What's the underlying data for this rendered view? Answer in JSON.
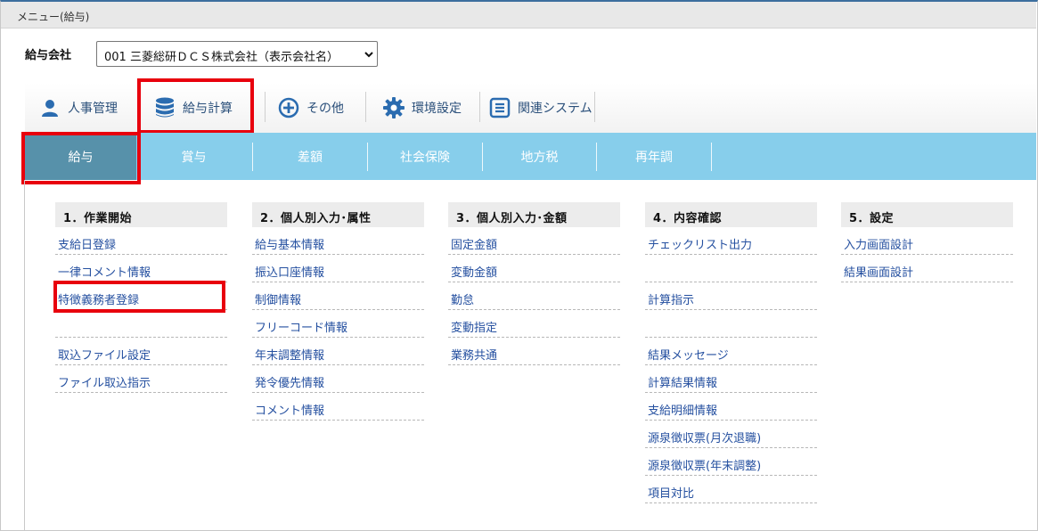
{
  "window": {
    "title": "メニュー(給与)"
  },
  "company": {
    "label": "給与会社",
    "selected": "001 三菱総研ＤＣＳ株式会社（表示会社名）"
  },
  "nav": [
    {
      "label": "人事管理",
      "icon": "person-icon"
    },
    {
      "label": "給与計算",
      "icon": "database-icon"
    },
    {
      "label": "その他",
      "icon": "plus-circle-icon"
    },
    {
      "label": "環境設定",
      "icon": "gear-icon"
    },
    {
      "label": "関連システム",
      "icon": "list-box-icon"
    }
  ],
  "tabs": [
    "給与",
    "賞与",
    "差額",
    "社会保険",
    "地方税",
    "再年調"
  ],
  "columns": [
    {
      "title": "1．作業開始",
      "items": [
        "支給日登録",
        "一律コメント情報",
        "特徴義務者登録",
        "",
        "取込ファイル設定",
        "ファイル取込指示"
      ]
    },
    {
      "title": "2．個人別入力･属性",
      "items": [
        "給与基本情報",
        "振込口座情報",
        "制御情報",
        "フリーコード情報",
        "年末調整情報",
        "発令優先情報",
        "コメント情報"
      ]
    },
    {
      "title": "3．個人別入力･金額",
      "items": [
        "固定金額",
        "変動金額",
        "勤怠",
        "変動指定",
        "業務共通"
      ]
    },
    {
      "title": "4．内容確認",
      "items": [
        "チェックリスト出力",
        "",
        "計算指示",
        "",
        "結果メッセージ",
        "計算結果情報",
        "支給明細情報",
        "源泉徴収票(月次退職)",
        "源泉徴収票(年末調整)",
        "項目対比"
      ]
    },
    {
      "title": "5．設定",
      "items": [
        "入力画面設計",
        "結果画面設計"
      ]
    }
  ],
  "colors": {
    "tab_bar": "#87ceeb",
    "tab_active": "#5791aa",
    "link": "#2550a0",
    "highlight": "#e8000d"
  }
}
